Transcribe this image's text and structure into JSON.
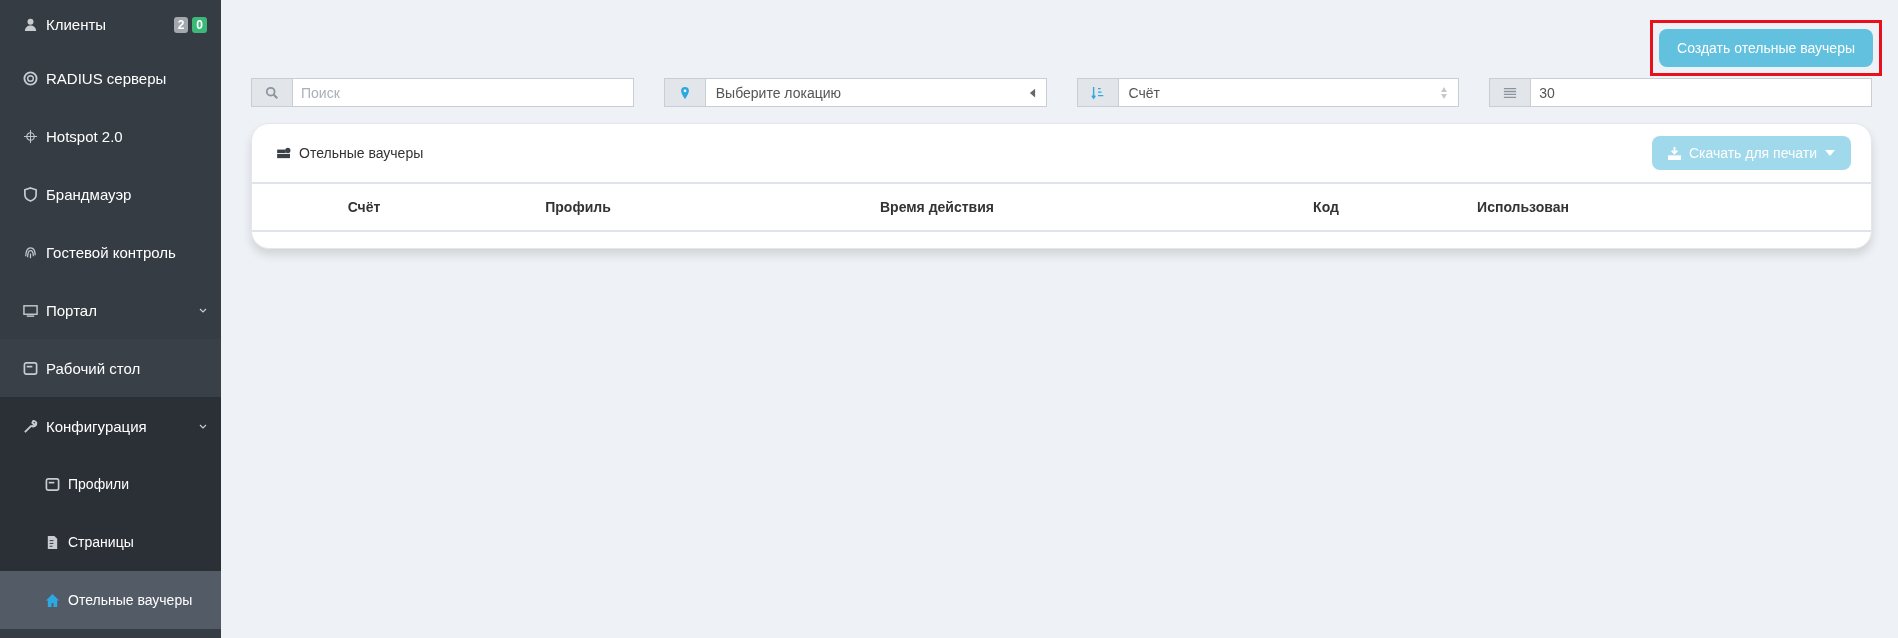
{
  "sidebar": {
    "items": [
      {
        "label": "Клиенты",
        "badges": [
          {
            "text": "2",
            "color": "#a3a8ae"
          },
          {
            "text": "0",
            "color": "#3cb878"
          }
        ],
        "selected": false
      },
      {
        "label": "RADIUS серверы",
        "selected": false
      },
      {
        "label": "Hotspot 2.0",
        "selected": false
      },
      {
        "label": "Брандмауэр",
        "selected": false
      },
      {
        "label": "Гостевой контроль",
        "selected": false
      },
      {
        "label": "Портал",
        "expanded": true,
        "selected": false
      },
      {
        "label": "Рабочий стол",
        "selected": false
      },
      {
        "label": "Конфигурация",
        "expanded": true,
        "selected": false,
        "children": [
          {
            "label": "Профили",
            "selected": false
          },
          {
            "label": "Страницы",
            "selected": false
          },
          {
            "label": "Отельные ваучеры",
            "selected": true
          }
        ]
      }
    ]
  },
  "create_button": {
    "label": "Создать отельные ваучеры",
    "highlighted": true
  },
  "filters": {
    "search": {
      "placeholder": "Поиск"
    },
    "location": {
      "value": "Выберите локацию"
    },
    "sort": {
      "value": "Счёт"
    },
    "per_page": {
      "value": "30"
    }
  },
  "card": {
    "title": "Отельные ваучеры",
    "download_button": {
      "label": "Скачать для печати",
      "disabled": true
    },
    "table": {
      "columns": [
        "Счёт",
        "Профиль",
        "Время действия",
        "Код",
        "Использован"
      ]
    }
  }
}
